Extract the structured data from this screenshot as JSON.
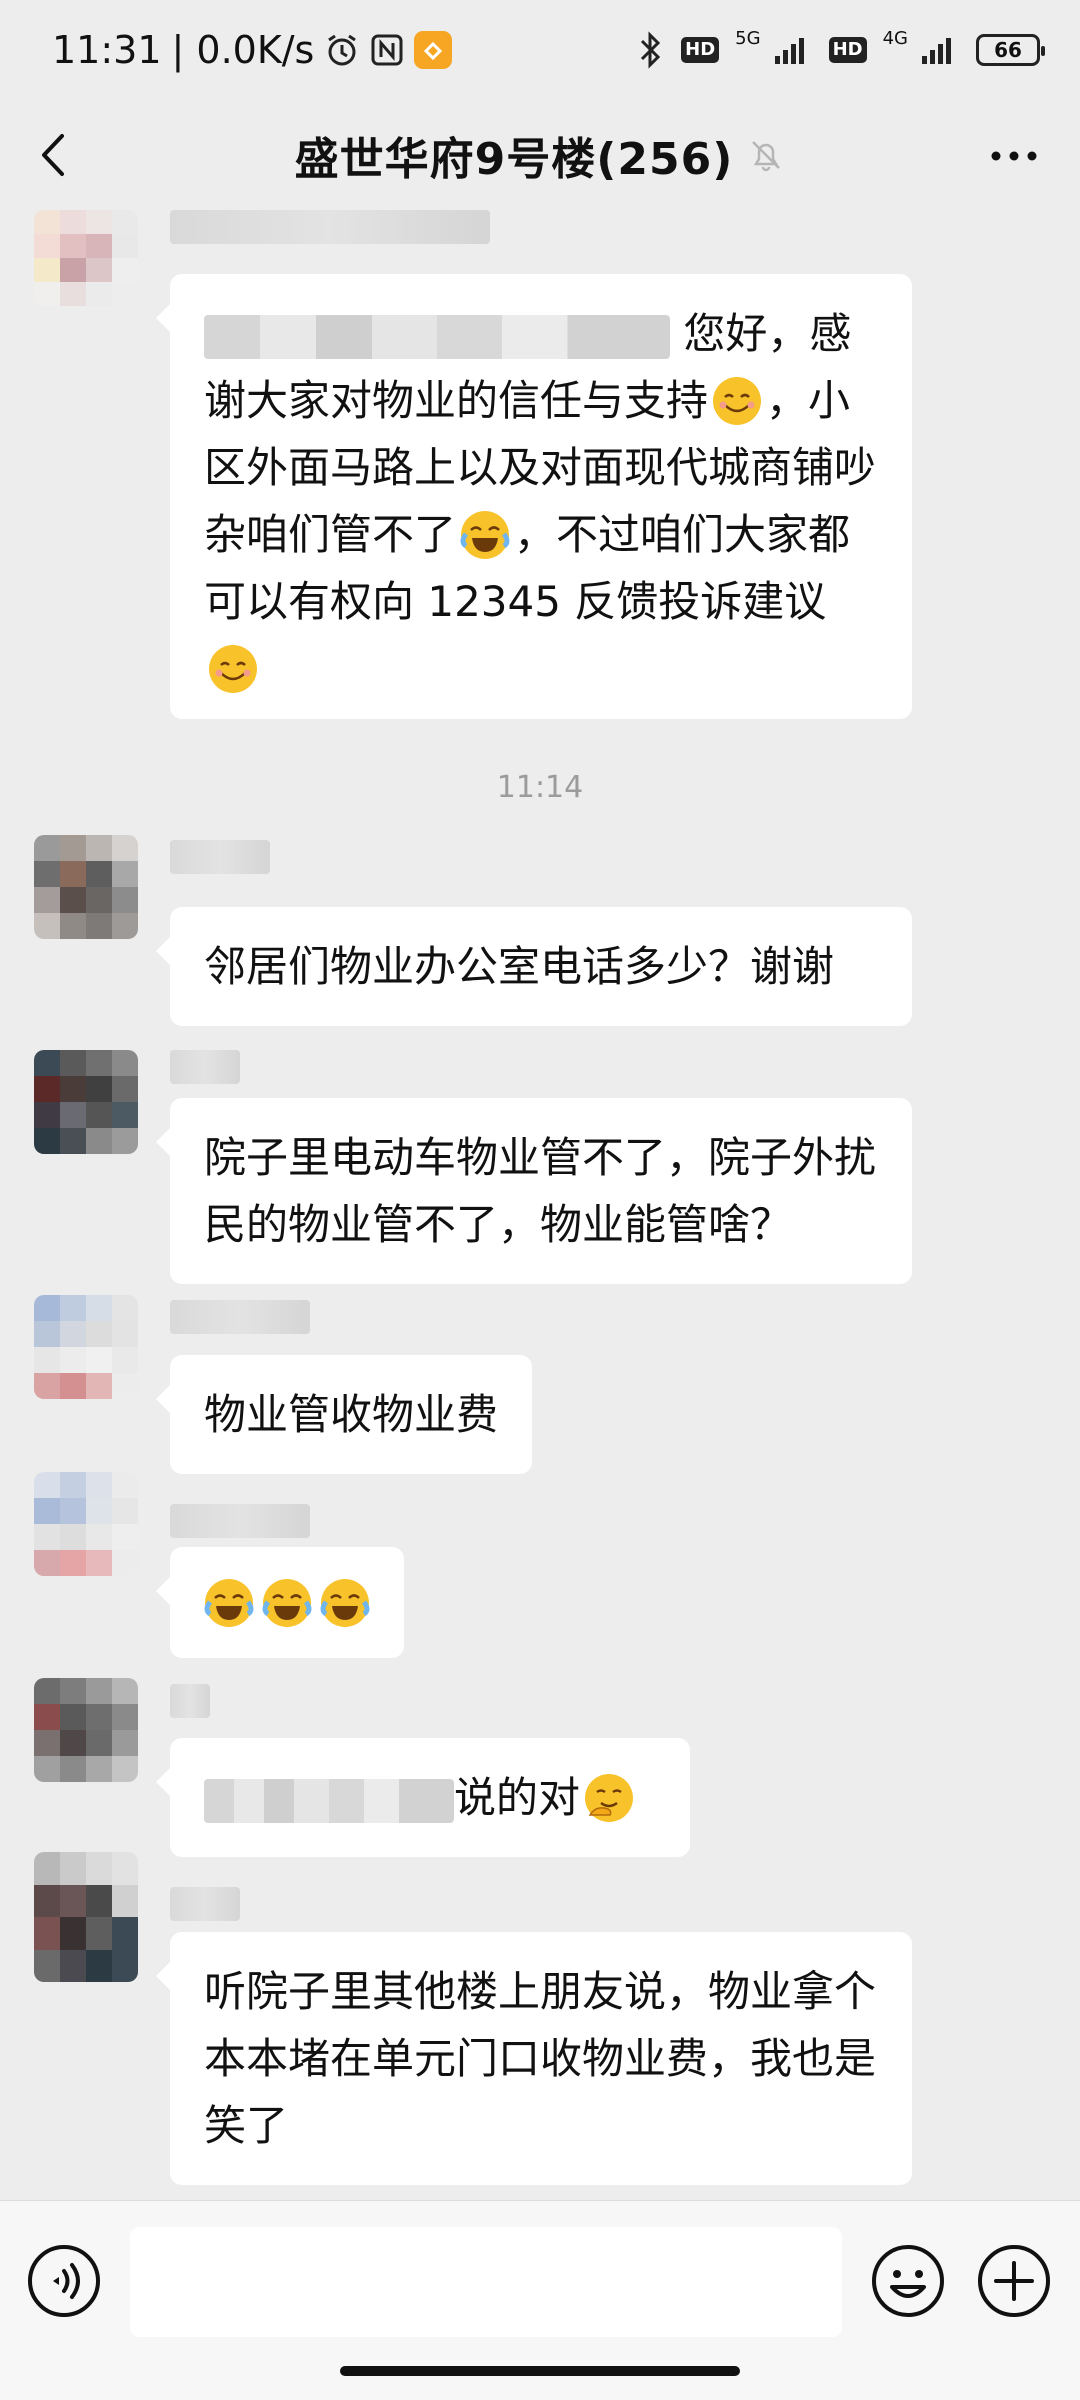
{
  "status_bar": {
    "time": "11:31",
    "net_speed": "| 0.0K/s",
    "net_5g": "5G",
    "net_4g": "4G",
    "hd": "HD",
    "battery": "66"
  },
  "header": {
    "title": "盛世华府9号楼(256)"
  },
  "messages": {
    "m1": {
      "greeting": "您好，感谢大家对物业的信任与支持",
      "line2": "，小区外面马路上以及对面现代城商铺吵杂咱们管不了",
      "line3": "，不过咱们大家都可以有权向 12345 反馈投诉建议"
    },
    "time_divider": "11:14",
    "m2": {
      "text": "邻居们物业办公室电话多少？谢谢"
    },
    "m3": {
      "text": "院子里电动车物业管不了，院子外扰民的物业管不了，物业能管啥？"
    },
    "m4": {
      "text": "物业管收物业费"
    },
    "m6": {
      "text": "说的对"
    },
    "m7": {
      "text": "听院子里其他楼上朋友说，物业拿个本本堵在单元门口收物业费，我也是笑了"
    }
  },
  "input": {
    "placeholder": ""
  },
  "colors": {
    "background": "#ededed",
    "bubble": "#ffffff",
    "emoji_yellow": "#f8c22b"
  },
  "icons": [
    "back-arrow-icon",
    "mute-bell-icon",
    "more-dots-icon",
    "voice-icon",
    "emoji-icon",
    "plus-icon",
    "smile-emoji",
    "laugh-cry-emoji",
    "thinking-emoji"
  ]
}
